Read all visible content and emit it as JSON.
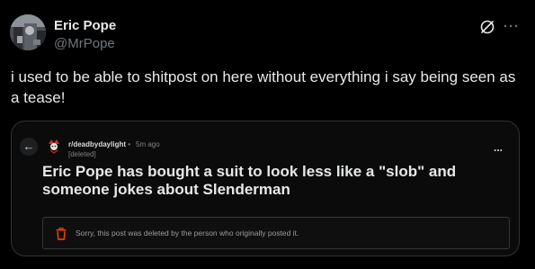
{
  "author": {
    "name": "Eric Pope",
    "handle": "@MrPope"
  },
  "tweet": {
    "text": "i used to be able to shitpost on here without everything i say being seen as a tease!"
  },
  "icons": {
    "grok": "grok-icon",
    "more": "more-icon",
    "back": "back-arrow-icon",
    "subreddit_avatar": "subreddit-avatar-icon",
    "trash": "trash-icon"
  },
  "embed": {
    "subreddit": "r/deadbydaylight",
    "separator": "•",
    "time_ago": "5m ago",
    "author": "[deleted]",
    "more_label": "...",
    "back_label": "←",
    "title": "Eric Pope has bought a suit to look less like a \"slob\" and someone jokes about Slenderman",
    "deleted_notice": "Sorry, this post was deleted by the person who originally posted it."
  },
  "colors": {
    "background": "#000000",
    "text": "#e7e9ea",
    "muted": "#71767b",
    "card_border": "#2f3336",
    "trash_red": "#ff4500"
  }
}
